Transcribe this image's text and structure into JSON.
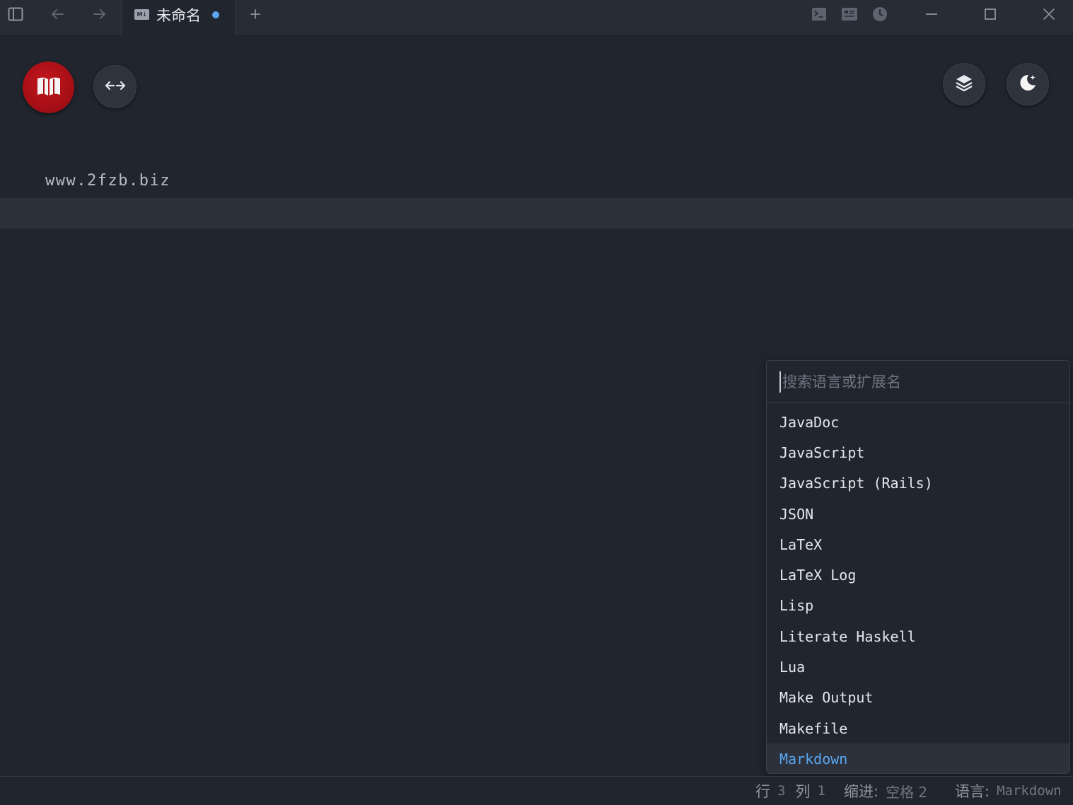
{
  "titlebar": {
    "tab": {
      "icon_text": "M↓",
      "title": "未命名",
      "modified": true
    },
    "icons": {
      "sidebar": "sidebar-toggle-icon",
      "back": "arrow-left-icon",
      "forward": "arrow-right-icon",
      "new_tab": "plus-icon",
      "terminal": "terminal-icon",
      "preview": "preview-icon",
      "history": "clock-icon",
      "minimize": "minimize-icon",
      "maximize": "maximize-icon",
      "close": "close-icon"
    }
  },
  "toolbar": {
    "icons": {
      "book": "book-open-icon",
      "swap": "swap-horizontal-icon",
      "layers": "layers-icon",
      "theme": "moon-star-icon"
    }
  },
  "editor": {
    "lines": [
      "www.2fzb.biz"
    ]
  },
  "language_picker": {
    "placeholder": "搜索语言或扩展名",
    "search_value": "",
    "items": [
      "JavaDoc",
      "JavaScript",
      "JavaScript (Rails)",
      "JSON",
      "LaTeX",
      "LaTeX Log",
      "Lisp",
      "Literate Haskell",
      "Lua",
      "Make Output",
      "Makefile",
      "Markdown"
    ],
    "selected": "Markdown"
  },
  "status": {
    "line_label": "行",
    "line_value": "3",
    "col_label": "列",
    "col_value": "1",
    "indent_label": "缩进:",
    "indent_value": "空格 2",
    "lang_label": "语言:",
    "lang_value": "Markdown"
  },
  "colors": {
    "background": "#21252e",
    "accent": "#5aa7f0",
    "book_button": "#a70f16"
  }
}
